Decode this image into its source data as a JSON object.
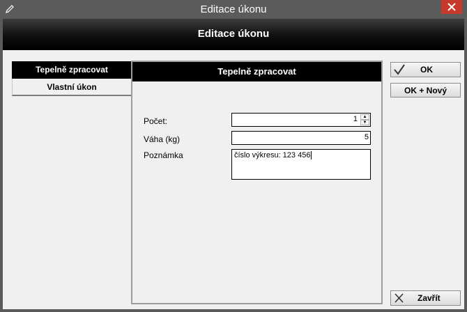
{
  "window": {
    "title": "Editace úkonu"
  },
  "header": {
    "title": "Editace úkonu"
  },
  "left_list": {
    "items": [
      {
        "label": "Tepelně zpracovat"
      },
      {
        "label": "Vlastní úkon"
      }
    ]
  },
  "panel": {
    "title": "Tepelně zpracovat",
    "fields": {
      "pocet": {
        "label": "Počet:",
        "value": "1"
      },
      "vaha": {
        "label": "Váha (kg)",
        "value": "5"
      },
      "poznamka": {
        "label": "Poznámka",
        "value": "číslo výkresu: 123 456"
      }
    }
  },
  "buttons": {
    "ok": "OK",
    "ok_new": "OK + Nový",
    "close": "Zavřít"
  },
  "icons": {
    "title_icon": "pencil-icon",
    "close": "close-icon",
    "ok": "checkmark-icon",
    "cancel": "x-icon"
  },
  "colors": {
    "close_button": "#c7392b",
    "header_bg": "#000000",
    "window_bg": "#f0f0f0",
    "titlebar_bg": "#5b5b5b"
  }
}
